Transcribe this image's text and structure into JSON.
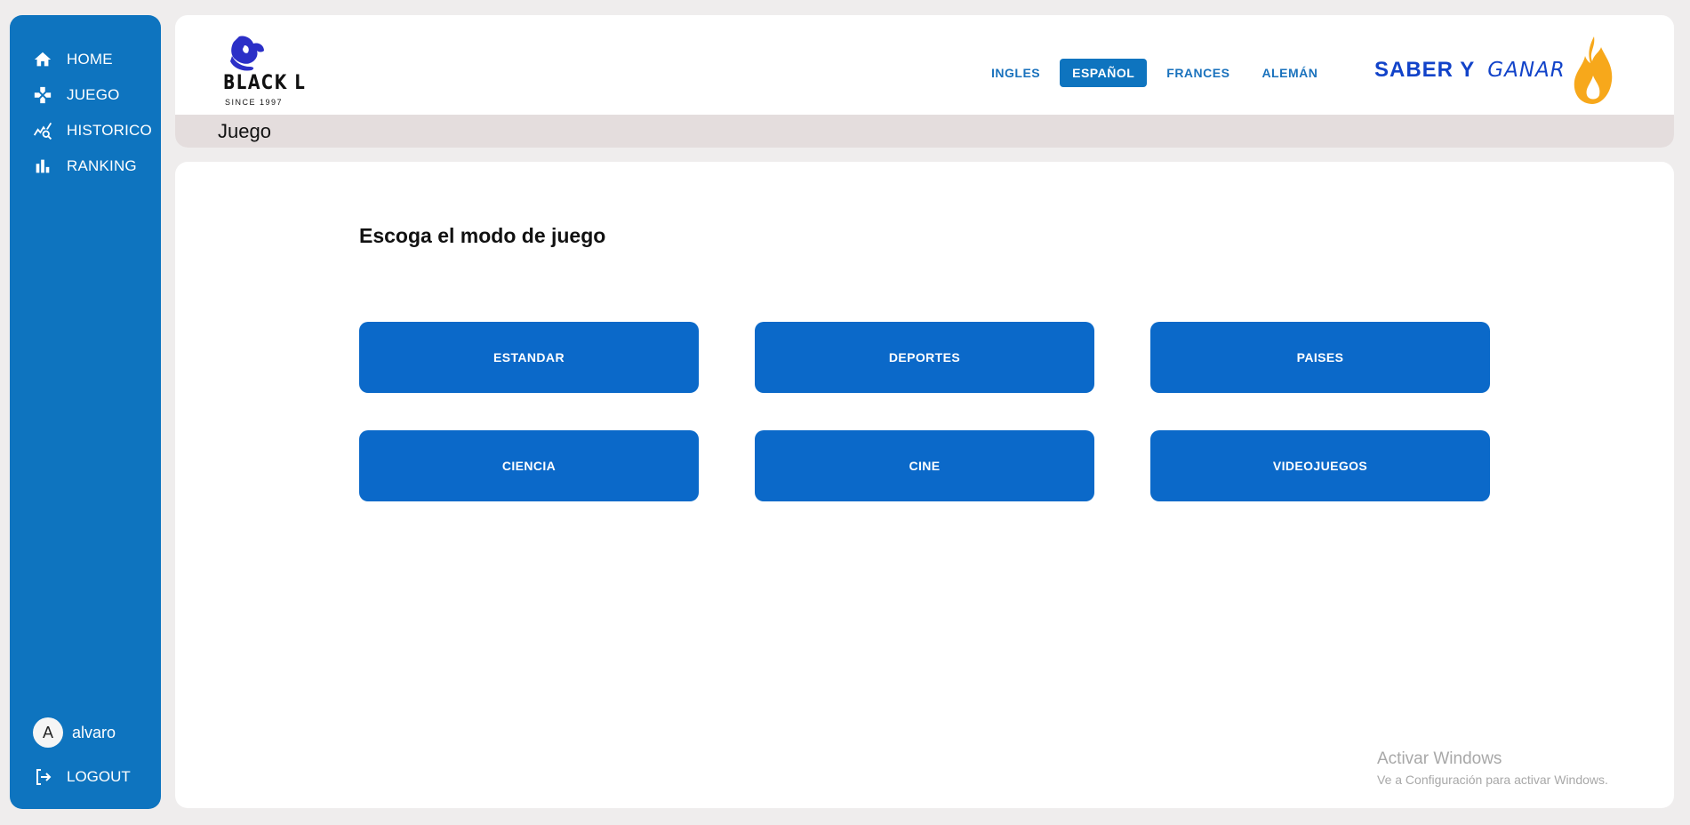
{
  "sidebar": {
    "items": [
      {
        "label": "HOME",
        "icon": "home-icon"
      },
      {
        "label": "JUEGO",
        "icon": "gamepad-icon"
      },
      {
        "label": "HISTORICO",
        "icon": "history-chart-icon"
      },
      {
        "label": "RANKING",
        "icon": "bar-chart-icon"
      }
    ],
    "user": {
      "initial": "A",
      "name": "alvaro"
    },
    "logout_label": "LOGOUT"
  },
  "header": {
    "logo": {
      "name": "BLACK L",
      "tagline": "SINCE 1997"
    },
    "languages": [
      {
        "label": "INGLES",
        "active": false
      },
      {
        "label": "ESPAÑOL",
        "active": true
      },
      {
        "label": "FRANCES",
        "active": false
      },
      {
        "label": "ALEMÁN",
        "active": false
      }
    ],
    "brand": {
      "part1": "SABER Y",
      "part2": "GANAR"
    },
    "page_title": "Juego"
  },
  "main": {
    "prompt": "Escoga el modo de juego",
    "modes": [
      "ESTANDAR",
      "DEPORTES",
      "PAISES",
      "CIENCIA",
      "CINE",
      "VIDEOJUEGOS"
    ]
  },
  "watermark": {
    "title": "Activar Windows",
    "subtitle": "Ve a Configuración para activar Windows."
  },
  "colors": {
    "sidebar": "#0e74bf",
    "mode_button": "#0b69c9",
    "brand_text": "#1243c9",
    "flame": "#f7a81b",
    "subheader": "#e4dddd"
  }
}
